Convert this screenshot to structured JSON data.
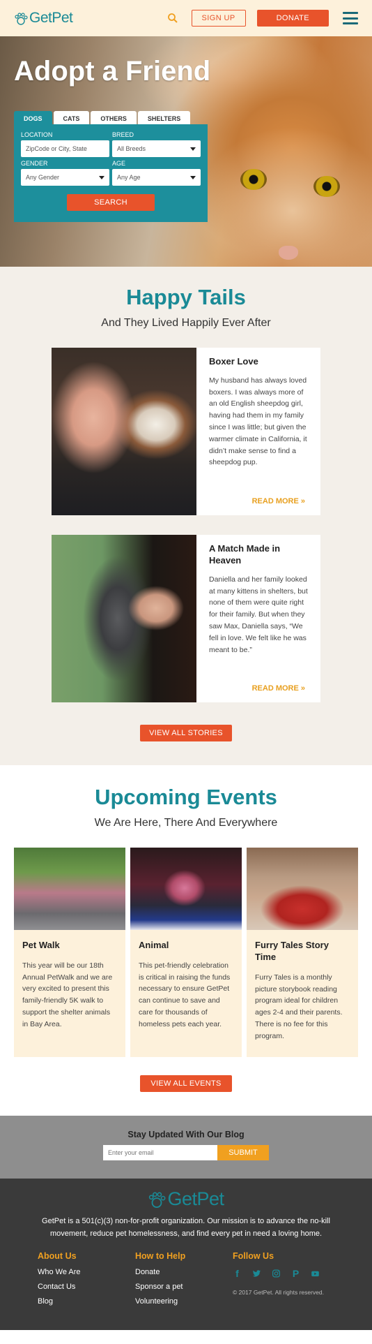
{
  "header": {
    "logo_text": "GetPet",
    "signup_label": "SIGN UP",
    "donate_label": "DONATE"
  },
  "hero": {
    "title": "Adopt a Friend",
    "tabs": [
      "DOGS",
      "CATS",
      "OTHERS",
      "SHELTERS"
    ],
    "location_label": "LOCATION",
    "location_placeholder": "ZipCode or City, State",
    "breed_label": "BREED",
    "breed_value": "All Breeds",
    "gender_label": "GENDER",
    "gender_value": "Any Gender",
    "age_label": "AGE",
    "age_value": "Any Age",
    "search_label": "SEARCH"
  },
  "tails": {
    "title": "Happy Tails",
    "subtitle": "And They Lived Happily Ever After",
    "stories": [
      {
        "title": "Boxer Love",
        "text": "My husband has always loved boxers. I was always more of an old English sheepdog girl, having had them in my family since I was little; but given the warmer climate in California, it didn’t make sense to find a sheepdog pup.",
        "read_more": "READ MORE »"
      },
      {
        "title": "A Match Made in Heaven",
        "text": "Daniella and her family looked at many kittens in shelters, but none of them were quite right for their family. But when they saw Max, Daniella says, “We fell in love. We felt like he was meant to be.”",
        "read_more": "READ MORE »"
      }
    ],
    "view_all_label": "VIEW ALL STORIES"
  },
  "events": {
    "title": "Upcoming Events",
    "subtitle": "We Are Here, There And Everywhere",
    "items": [
      {
        "title": "Pet Walk",
        "text": "This year will be our 18th Annual PetWalk and we are very excited to present this family-friendly 5K walk to support the shelter animals in Bay Area."
      },
      {
        "title": "Animal",
        "text": "This pet-friendly celebration is critical in raising the funds necessary to ensure GetPet can continue to save and care for thousands of homeless pets each year."
      },
      {
        "title": "Furry Tales Story Time",
        "text": "Furry Tales is a monthly picture storybook reading program ideal for children ages 2-4 and their parents. There is no fee for this program."
      }
    ],
    "view_all_label": "VIEW ALL EVENTS"
  },
  "blog": {
    "title": "Stay Updated With Our Blog",
    "email_placeholder": "Enter your email",
    "submit_label": "SUBMIT"
  },
  "footer": {
    "logo_text": "GetPet",
    "mission": "GetPet is a 501(c)(3) non-for-profit organization. Our mission is to advance the no-kill movement, reduce pet homelessness, and find every pet in need a loving home.",
    "about_heading": "About Us",
    "about_links": [
      "Who We Are",
      "Contact Us",
      "Blog"
    ],
    "help_heading": "How to Help",
    "help_links": [
      "Donate",
      "Sponsor a pet",
      "Volunteering"
    ],
    "follow_heading": "Follow Us",
    "social_icons": [
      "facebook-icon",
      "twitter-icon",
      "instagram-icon",
      "pinterest-icon",
      "youtube-icon"
    ],
    "copyright": "© 2017 GetPet.  All rights reserved."
  },
  "colors": {
    "teal": "#1a8a96",
    "orange": "#e8532b",
    "amber": "#f0a020",
    "cream": "#fdf1db"
  }
}
